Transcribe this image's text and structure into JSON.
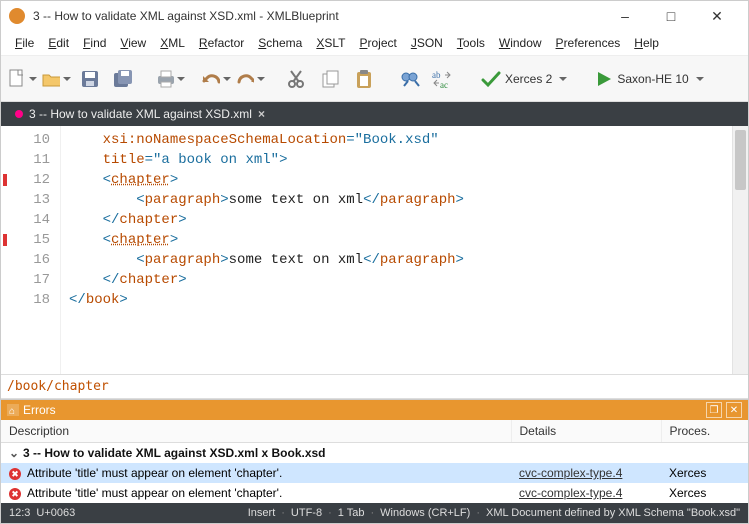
{
  "window": {
    "title": "3 -- How to validate XML against XSD.xml - XMLBlueprint"
  },
  "menu": [
    "File",
    "Edit",
    "Find",
    "View",
    "XML",
    "Refactor",
    "Schema",
    "XSLT",
    "Project",
    "JSON",
    "Tools",
    "Window",
    "Preferences",
    "Help"
  ],
  "toolbar": {
    "validator_label": "Xerces 2",
    "run_label": "Saxon-HE 10"
  },
  "tab": {
    "label": "3 -- How to validate XML against XSD.xml"
  },
  "editor": {
    "lines": [
      {
        "n": "10",
        "marker": false,
        "html": "    <span class='t-attr'>xsi:noNamespaceSchemaLocation</span><span class='t-punc'>=</span><span class='t-val'>\"Book.xsd\"</span>"
      },
      {
        "n": "11",
        "marker": false,
        "html": "    <span class='t-attr'>title</span><span class='t-punc'>=</span><span class='t-val'>\"a book on xml\"</span><span class='t-punc'>&gt;</span>"
      },
      {
        "n": "12",
        "marker": true,
        "html": "    <span class='t-punc'>&lt;</span><span class='t-link'>chapter</span><span class='t-punc'>&gt;</span>"
      },
      {
        "n": "13",
        "marker": false,
        "html": "        <span class='t-punc'>&lt;</span><span class='t-tag'>paragraph</span><span class='t-punc'>&gt;</span><span class='t-text'>some text on xml</span><span class='t-punc'>&lt;/</span><span class='t-tag'>paragraph</span><span class='t-punc'>&gt;</span>"
      },
      {
        "n": "14",
        "marker": false,
        "html": "    <span class='t-punc'>&lt;/</span><span class='t-tag'>chapter</span><span class='t-punc'>&gt;</span>"
      },
      {
        "n": "15",
        "marker": true,
        "html": "    <span class='t-punc'>&lt;</span><span class='t-link'>chapter</span><span class='t-punc'>&gt;</span>"
      },
      {
        "n": "16",
        "marker": false,
        "html": "        <span class='t-punc'>&lt;</span><span class='t-tag'>paragraph</span><span class='t-punc'>&gt;</span><span class='t-text'>some text on xml</span><span class='t-punc'>&lt;/</span><span class='t-tag'>paragraph</span><span class='t-punc'>&gt;</span>"
      },
      {
        "n": "17",
        "marker": false,
        "html": "    <span class='t-punc'>&lt;/</span><span class='t-tag'>chapter</span><span class='t-punc'>&gt;</span>"
      },
      {
        "n": "18",
        "marker": false,
        "html": "<span class='t-punc'>&lt;/</span><span class='t-tag'>book</span><span class='t-punc'>&gt;</span>"
      }
    ]
  },
  "breadcrumb": "/book/chapter",
  "errors": {
    "panel_title": "Errors",
    "columns": [
      "Description",
      "Details",
      "Proces."
    ],
    "group": "3 -- How to validate XML against XSD.xml x Book.xsd",
    "rows": [
      {
        "msg": "Attribute 'title' must appear on element 'chapter'.",
        "detail": "cvc-complex-type.4",
        "proc": "Xerces",
        "selected": true
      },
      {
        "msg": "Attribute 'title' must appear on element 'chapter'.",
        "detail": "cvc-complex-type.4",
        "proc": "Xerces",
        "selected": false
      }
    ]
  },
  "status": {
    "line_col": "12:3",
    "codepoint": "U+0063",
    "mode": "Insert",
    "encoding": "UTF-8",
    "tabs": "1 Tab",
    "eol": "Windows (CR+LF)",
    "doctype": "XML Document defined by XML Schema \"Book.xsd\""
  }
}
